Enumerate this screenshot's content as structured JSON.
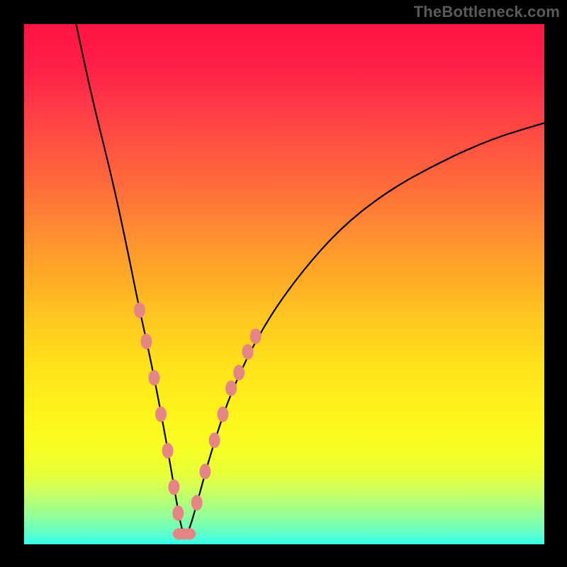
{
  "watermark": "TheBottleneck.com",
  "chart_data": {
    "type": "line",
    "title": "",
    "xlabel": "",
    "ylabel": "",
    "xlim": [
      0,
      100
    ],
    "ylim": [
      0,
      100
    ],
    "curve": {
      "name": "bottleneck-curve",
      "x": [
        10,
        13,
        17,
        20,
        22,
        24,
        26,
        28,
        29.5,
        30.5,
        31.5,
        33,
        36,
        40,
        46,
        53,
        61,
        70,
        80,
        90,
        100
      ],
      "y": [
        100,
        86,
        70,
        56,
        46,
        37,
        27,
        16,
        7,
        2,
        2,
        7,
        18,
        30,
        42,
        52,
        61,
        68,
        73.5,
        78,
        81
      ]
    },
    "highlight_dots_left": {
      "color": "#e58585",
      "x": [
        22.2,
        23.5,
        25.0,
        26.3,
        27.6,
        28.8,
        29.6
      ],
      "y": [
        45,
        39,
        32,
        25,
        18,
        11,
        6
      ]
    },
    "highlight_dots_right": {
      "color": "#e58585",
      "x": [
        33.2,
        34.8,
        36.6,
        38.2,
        39.8,
        41.3,
        43.0,
        44.5
      ],
      "y": [
        8,
        14,
        20,
        25,
        30,
        33,
        37,
        40
      ]
    },
    "highlight_dots_bottom": {
      "color": "#e58585",
      "x": [
        29.8,
        30.8,
        31.8
      ],
      "y": [
        2,
        2,
        2
      ]
    }
  }
}
